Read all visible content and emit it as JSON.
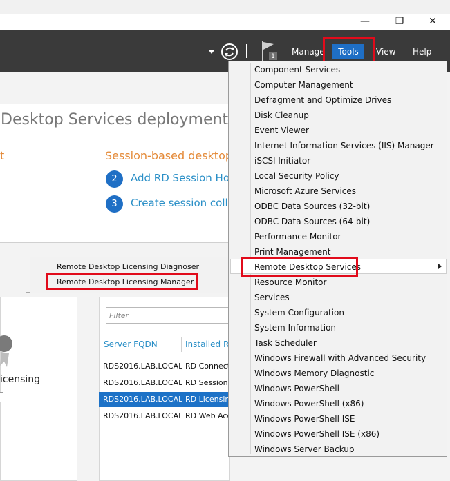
{
  "window": {
    "restore_glyph": "❐",
    "close_glyph": "✕"
  },
  "toolbar": {
    "notification_count": "1",
    "menus": [
      "Manage",
      "Tools",
      "View",
      "Help"
    ]
  },
  "deployment": {
    "title": "Desktop Services deployment",
    "left_header_fragment": "t",
    "session_header": "Session-based desktop",
    "steps": [
      {
        "num": "2",
        "label": "Add RD Session Hos"
      },
      {
        "num": "3",
        "label": "Create session colle"
      }
    ]
  },
  "context_menu": {
    "items": [
      "Remote Desktop Licensing Diagnoser",
      "Remote Desktop Licensing Manager"
    ]
  },
  "left_card": {
    "label": "icensing"
  },
  "servers": {
    "filter_placeholder": "Filter",
    "columns": [
      "Server FQDN",
      "Installed Ro"
    ],
    "rows": [
      {
        "fqdn": "RDS2016.LAB.LOCAL",
        "role": "RD Connect",
        "selected": false
      },
      {
        "fqdn": "RDS2016.LAB.LOCAL",
        "role": "RD Session",
        "selected": false
      },
      {
        "fqdn": "RDS2016.LAB.LOCAL",
        "role": "RD Licensin",
        "selected": true
      },
      {
        "fqdn": "RDS2016.LAB.LOCAL",
        "role": "RD Web Acc",
        "selected": false
      }
    ]
  },
  "tools_menu": {
    "items": [
      "Component Services",
      "Computer Management",
      "Defragment and Optimize Drives",
      "Disk Cleanup",
      "Event Viewer",
      "Internet Information Services (IIS) Manager",
      "iSCSI Initiator",
      "Local Security Policy",
      "Microsoft Azure Services",
      "ODBC Data Sources (32-bit)",
      "ODBC Data Sources (64-bit)",
      "Performance Monitor",
      "Print Management",
      "Remote Desktop Services",
      "Resource Monitor",
      "Services",
      "System Configuration",
      "System Information",
      "Task Scheduler",
      "Windows Firewall with Advanced Security",
      "Windows Memory Diagnostic",
      "Windows PowerShell",
      "Windows PowerShell (x86)",
      "Windows PowerShell ISE",
      "Windows PowerShell ISE (x86)",
      "Windows Server Backup"
    ]
  },
  "colors": {
    "accent": "#1f6fc5",
    "highlight_box": "#e10b1b",
    "toolbar_bg": "#3a3a3a",
    "orange_text": "#e48a38"
  }
}
